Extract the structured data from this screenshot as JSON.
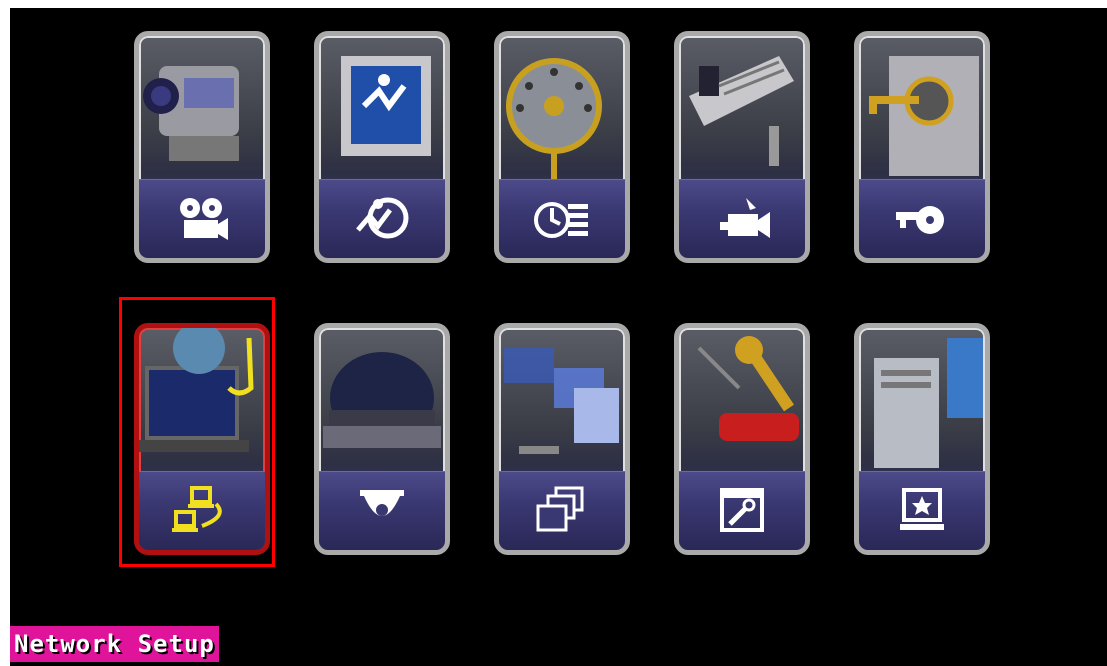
{
  "menu": {
    "selected_label": "Network Setup",
    "tiles": [
      {
        "icon": "record-film-camera-icon",
        "selected": false
      },
      {
        "icon": "motion-detection-icon",
        "selected": false
      },
      {
        "icon": "schedule-clock-icon",
        "selected": false
      },
      {
        "icon": "camera-setup-icon",
        "selected": false
      },
      {
        "icon": "password-key-icon",
        "selected": false
      },
      {
        "icon": "network-setup-icon",
        "selected": true
      },
      {
        "icon": "ptz-dome-camera-icon",
        "selected": false
      },
      {
        "icon": "file-management-icon",
        "selected": false
      },
      {
        "icon": "system-tools-icon",
        "selected": false
      },
      {
        "icon": "system-info-icon",
        "selected": false
      }
    ]
  },
  "colors": {
    "selection": "#ff0000",
    "label_bg": "#e0149a",
    "icon_accent": "#f0e020"
  }
}
